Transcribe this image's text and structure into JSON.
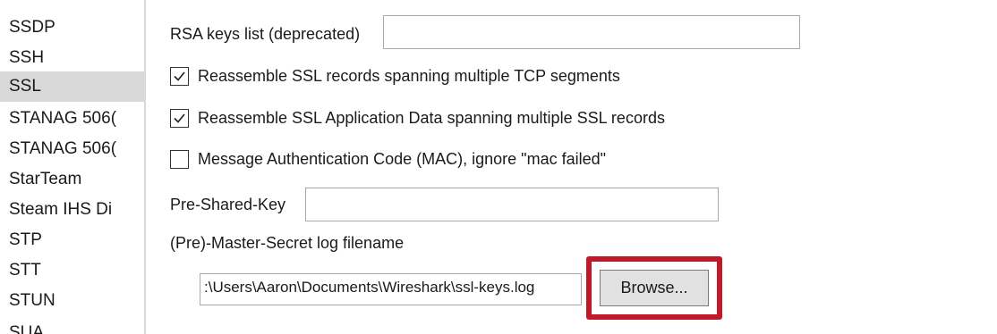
{
  "sidebar": {
    "items": [
      {
        "label": "SSDP",
        "selected": false
      },
      {
        "label": "SSH",
        "selected": false
      },
      {
        "label": "SSL",
        "selected": true
      },
      {
        "label": "STANAG 506(",
        "selected": false
      },
      {
        "label": "STANAG 506(",
        "selected": false
      },
      {
        "label": "StarTeam",
        "selected": false
      },
      {
        "label": "Steam IHS Di",
        "selected": false
      },
      {
        "label": "STP",
        "selected": false
      },
      {
        "label": "STT",
        "selected": false
      },
      {
        "label": "STUN",
        "selected": false
      },
      {
        "label": "SUA",
        "selected": false
      }
    ]
  },
  "panel": {
    "rsa_keys": {
      "label": "RSA keys list (deprecated)",
      "value": ""
    },
    "options": [
      {
        "label": "Reassemble SSL records spanning multiple TCP segments",
        "checked": true
      },
      {
        "label": "Reassemble SSL Application Data spanning multiple SSL records",
        "checked": true
      },
      {
        "label": "Message Authentication Code (MAC), ignore \"mac failed\"",
        "checked": false
      }
    ],
    "psk": {
      "label": "Pre-Shared-Key",
      "value": ""
    },
    "master_secret": {
      "label": "(Pre)-Master-Secret log filename",
      "value": ":\\Users\\Aaron\\Documents\\Wireshark\\ssl-keys.log"
    },
    "browse_label": "Browse...",
    "highlight_color": "#c3172a"
  }
}
